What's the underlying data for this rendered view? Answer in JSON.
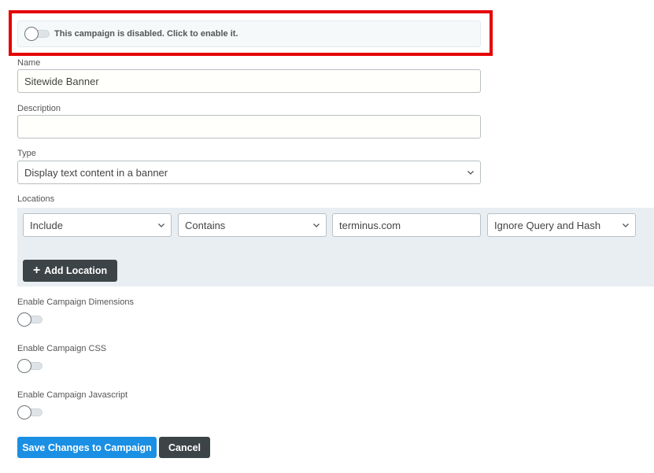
{
  "campaign_status": {
    "text": "This campaign is disabled. Click to enable it.",
    "enabled": false
  },
  "name_field": {
    "label": "Name",
    "value": "Sitewide Banner"
  },
  "description_field": {
    "label": "Description",
    "value": ""
  },
  "type_field": {
    "label": "Type",
    "selected": "Display text content in a banner"
  },
  "locations": {
    "label": "Locations",
    "rule": {
      "include_mode": "Include",
      "match_type": "Contains",
      "value": "terminus.com",
      "query_option": "Ignore Query and Hash"
    },
    "add_button_label": "Add Location"
  },
  "options": {
    "dimensions_label": "Enable Campaign Dimensions",
    "css_label": "Enable Campaign CSS",
    "javascript_label": "Enable Campaign Javascript"
  },
  "actions": {
    "save_label": "Save Changes to Campaign",
    "cancel_label": "Cancel"
  },
  "colors": {
    "highlight": "#e50000",
    "primary": "#1a8fe3",
    "dark": "#3d4447",
    "panel": "#e8eef1"
  }
}
